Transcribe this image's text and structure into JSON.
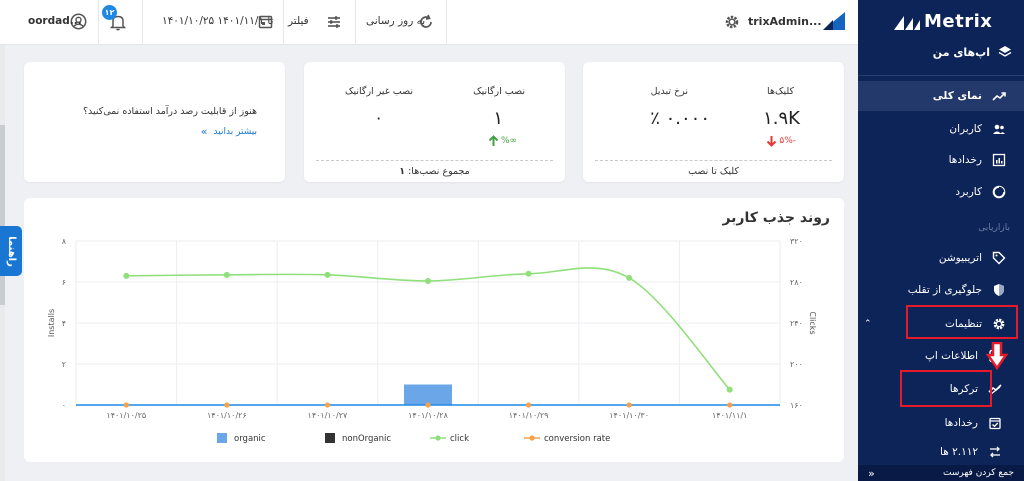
{
  "sidebar": {
    "logo": "Metrix",
    "apps_label": "اپ‌های من",
    "items": [
      {
        "label": "نمای کلی",
        "icon": "trend-up-icon"
      },
      {
        "label": "کاربران",
        "icon": "users-icon"
      },
      {
        "label": "رخدادها",
        "icon": "chart-icon"
      },
      {
        "label": "کاربرد",
        "icon": "pie-icon"
      }
    ],
    "section_label": "بازاریابی",
    "marketing_items": [
      {
        "label": "اتریبیوشن",
        "icon": "tag-icon"
      },
      {
        "label": "جلوگیری از تقلب",
        "icon": "shield-icon"
      },
      {
        "label": "تنظیمات",
        "icon": "gear-icon"
      },
      {
        "label": "اطلاعات اپ",
        "icon": "app-info-icon"
      },
      {
        "label": "ترکرها",
        "icon": "tracker-icon"
      },
      {
        "label": "رخدادها",
        "icon": "calendar-check-icon"
      },
      {
        "label": "۲.۱۱۲ ها",
        "icon": "arrows-icon"
      }
    ],
    "collapse_label": "جمع کردن فهرست",
    "collapse_icon": "double-chevron-left-icon"
  },
  "topbar": {
    "app_name": "trixAdmin...",
    "refresh_label": "به روز رسانی",
    "filter_label": "فیلتر",
    "date_range": "۱۴۰۱/۱۰/۲۵ تا ۱۴۰۱/۱۱/۱",
    "notif_count": "۱۲",
    "user_name": "oordad..."
  },
  "guide_label": "راهنما",
  "cards": {
    "clicks": {
      "label": "کلیک‌ها",
      "value": "۱.۹K",
      "delta": "۵%-",
      "conv_label": "نرخ تبدیل",
      "conv_value": "٪ ۰.۰۰۰",
      "footer": "کلیک تا نصب"
    },
    "installs": {
      "organic_label": "نصب ارگانیک",
      "organic_value": "۱",
      "organic_delta": "%∞",
      "nonorganic_label": "نصب غیر ارگانیک",
      "nonorganic_value": "۰",
      "footer_label": "مجموع نصب‌ها:",
      "footer_value": "۱"
    },
    "promo": {
      "question": "هنوز از قابلیت رصد درآمد استفاده نمی‌کنید؟",
      "link": "بیشتر بدانید"
    }
  },
  "chart_data": {
    "type": "bar+line",
    "title": "روند جذب کاربر",
    "categories": [
      "۱۴۰۱/۱۰/۲۵",
      "۱۴۰۱/۱۰/۲۶",
      "۱۴۰۱/۱۰/۲۷",
      "۱۴۰۱/۱۰/۲۸",
      "۱۴۰۱/۱۰/۲۹",
      "۱۴۰۱/۱۰/۳۰",
      "۱۴۰۱/۱۱/۱"
    ],
    "ylabel_left": "Installs",
    "ylabel_right": "Clicks",
    "ylim_left": [
      0,
      8
    ],
    "yticks_left": [
      "۰",
      "۲",
      "۴",
      "۶",
      "۸"
    ],
    "ylim_right": [
      160,
      320
    ],
    "yticks_right": [
      "۱۶۰",
      "۲۰۰",
      "۲۴۰",
      "۲۸۰",
      "۳۲۰"
    ],
    "series": [
      {
        "name": "organic",
        "type": "bar",
        "axis": "left",
        "color": "#6aa6e8",
        "values": [
          0,
          0,
          0,
          1,
          0,
          0,
          0
        ]
      },
      {
        "name": "nonOrganic",
        "type": "bar",
        "axis": "left",
        "color": "#333333",
        "values": [
          0,
          0,
          0,
          0,
          0,
          0,
          0
        ]
      },
      {
        "name": "click",
        "type": "line",
        "axis": "right",
        "color": "#8fe07a",
        "values": [
          286,
          287,
          287,
          281,
          288,
          284,
          175
        ]
      },
      {
        "name": "conversion rate",
        "type": "line",
        "axis": "left",
        "color": "#f5a04a",
        "values": [
          0,
          0,
          0,
          0,
          0,
          0,
          0
        ]
      }
    ]
  }
}
